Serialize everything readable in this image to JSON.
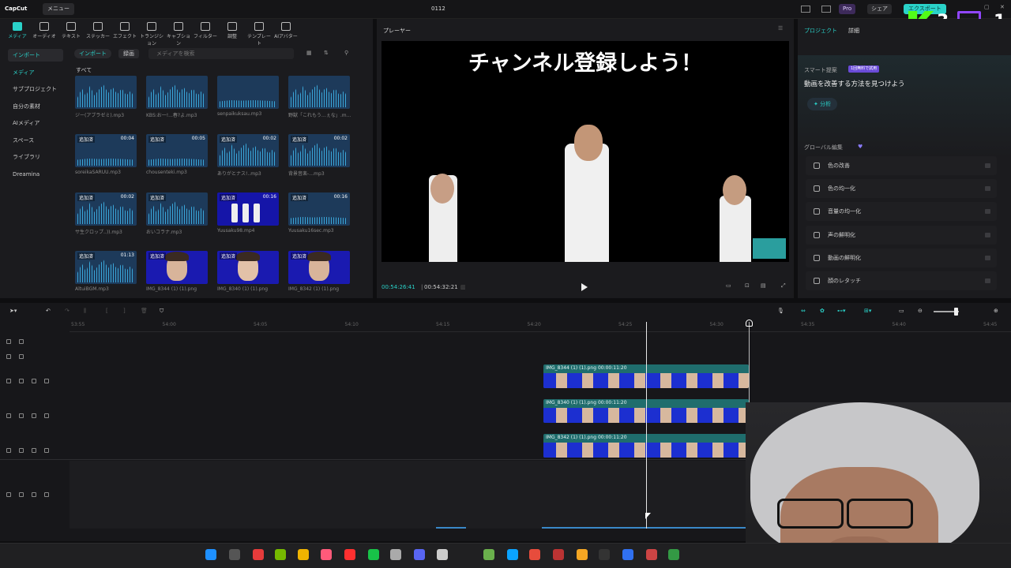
{
  "app": {
    "name": "CapCut",
    "menu": "メニュー",
    "title": "0112",
    "pro": "Pro",
    "share": "シェア",
    "export": "エクスポート"
  },
  "stream_overlay": {
    "k_count": "3",
    "t_count": "1"
  },
  "toolbar_tabs": [
    {
      "label": "メディア",
      "icon": "media-icon",
      "active": true
    },
    {
      "label": "オーディオ",
      "icon": "audio-icon"
    },
    {
      "label": "テキスト",
      "icon": "text-icon"
    },
    {
      "label": "ステッカー",
      "icon": "sticker-icon"
    },
    {
      "label": "エフェクト",
      "icon": "effect-icon"
    },
    {
      "label": "トランジション",
      "icon": "transition-icon"
    },
    {
      "label": "キャプション",
      "icon": "caption-icon"
    },
    {
      "label": "フィルター",
      "icon": "filter-icon"
    },
    {
      "label": "調整",
      "icon": "adjust-icon"
    },
    {
      "label": "テンプレート",
      "icon": "template-icon"
    },
    {
      "label": "AIアバター",
      "icon": "ai-avatar-icon"
    }
  ],
  "sidebar": [
    {
      "label": "インポート",
      "active": true
    },
    {
      "label": "メディア",
      "highlight": true
    },
    {
      "label": "サブプロジェクト"
    },
    {
      "label": "自分の素材"
    },
    {
      "label": "AIメディア"
    },
    {
      "label": "スペース"
    },
    {
      "label": "ライブラリ"
    },
    {
      "label": "Dreamina"
    }
  ],
  "media_toolbar": {
    "import": "インポート",
    "record": "録画",
    "search_placeholder": "メディアを検索"
  },
  "media_filter": "すべて",
  "media_items": [
    {
      "name": "ジー(アブラゼミ).mp3",
      "type": "audio"
    },
    {
      "name": "KBS:お一!...春?よ.mp3",
      "type": "audio"
    },
    {
      "name": "senpaikuksau.mp3",
      "type": "audio",
      "low": true
    },
    {
      "name": "野獣「これもう…ぇな」.mp3",
      "type": "audio"
    },
    {
      "name": "soreikaSARUU.mp3",
      "type": "audio",
      "badge": "追加済",
      "duration": "00:04",
      "low": true
    },
    {
      "name": "chousenteki.mp3",
      "type": "audio",
      "badge": "追加済",
      "duration": "00:05",
      "low": true
    },
    {
      "name": "ありがとナス!..mp3",
      "type": "audio",
      "badge": "追加済",
      "duration": "00:02"
    },
    {
      "name": "背景音楽-…mp3",
      "type": "audio",
      "badge": "追加済",
      "duration": "00:02"
    },
    {
      "name": "サ生クロップ..)).mp3",
      "type": "audio",
      "badge": "追加済",
      "duration": "00:02"
    },
    {
      "name": "おいコラナ.mp3",
      "type": "audio",
      "badge": "追加済"
    },
    {
      "name": "Yuusaku98.mp4",
      "type": "video",
      "badge": "追加済",
      "duration": "00:16"
    },
    {
      "name": "Yuusaku16sec.mp3",
      "type": "audio",
      "badge": "追加済",
      "duration": "00:16",
      "low": true
    },
    {
      "name": "AltuiBGM.mp3",
      "type": "audio",
      "badge": "追加済",
      "duration": "01:13"
    },
    {
      "name": "IMG_8344 (1) (1).png",
      "type": "image",
      "badge": "追加済"
    },
    {
      "name": "IMG_8340 (1) (1).png",
      "type": "image",
      "badge": "追加済",
      "female": true
    },
    {
      "name": "IMG_8342 (1) (1).png",
      "type": "image",
      "badge": "追加済"
    }
  ],
  "player": {
    "title": "プレーヤー",
    "subtitle": "チャンネル登録しよう！",
    "current_time": "00:54:26:41",
    "total_time": "00:54:32:21"
  },
  "properties": {
    "tabs": [
      "プロジェクト",
      "詳細"
    ],
    "smart_label": "スマート提案",
    "smart_badge": "1回無料で試用",
    "smart_text": "動画を改善する方法を見つけよう",
    "analyze": "分析",
    "global_edit": "グローバル編集",
    "global_items": [
      {
        "label": "色の改善",
        "icon": "color-enhance-icon"
      },
      {
        "label": "色の均一化",
        "icon": "color-match-icon"
      },
      {
        "label": "音量の均一化",
        "icon": "volume-icon"
      },
      {
        "label": "声の鮮明化",
        "icon": "voice-icon"
      },
      {
        "label": "動画の鮮明化",
        "icon": "hd-icon"
      },
      {
        "label": "顔のレタッチ",
        "icon": "face-retouch-icon"
      }
    ]
  },
  "timeline": {
    "ruler": [
      "53:55",
      "54:00",
      "54:05",
      "54:10",
      "54:15",
      "54:20",
      "54:25",
      "54:30",
      "54:35",
      "54:40",
      "54:45"
    ],
    "clips": [
      {
        "label": "IMG_8344 (1) (1).png",
        "duration": "00:00:11:20"
      },
      {
        "label": "IMG_8340 (1) (1).png",
        "duration": "00:00:11:20"
      },
      {
        "label": "IMG_8342 (1) (1).png",
        "duration": "00:00:11:20"
      }
    ]
  },
  "colors": {
    "accent": "#2ad2c9",
    "clip_teal": "#1f6d6d",
    "image_blue": "#1c2fd0"
  }
}
